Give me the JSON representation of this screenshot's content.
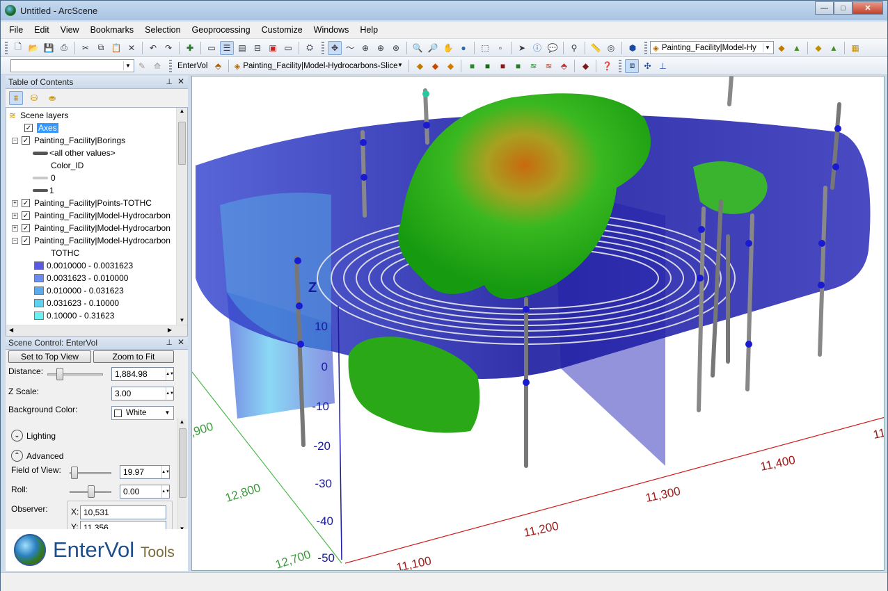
{
  "window": {
    "title": "Untitled - ArcScene",
    "minimize": "—",
    "maximize": "□",
    "close": "✕"
  },
  "menu": [
    "File",
    "Edit",
    "View",
    "Bookmarks",
    "Selection",
    "Geoprocessing",
    "Customize",
    "Windows",
    "Help"
  ],
  "toolbar": {
    "layer_combo": "Painting_Facility|Model-Hy",
    "entervol_label": "EnterVol",
    "slice_combo": "Painting_Facility|Model-Hydrocarbons-Slice"
  },
  "toc": {
    "title": "Table of Contents",
    "root": "Scene layers",
    "rows": [
      {
        "label": "Axes"
      },
      {
        "label": "Painting_Facility|Borings"
      },
      {
        "label": "<all other values>"
      },
      {
        "label": "Color_ID"
      },
      {
        "label": "0"
      },
      {
        "label": "1"
      },
      {
        "label": "Painting_Facility|Points-TOTHC"
      },
      {
        "label": "Painting_Facility|Model-Hydrocarbon"
      },
      {
        "label": "Painting_Facility|Model-Hydrocarbon"
      },
      {
        "label": "Painting_Facility|Model-Hydrocarbon"
      },
      {
        "label": "TOTHC"
      }
    ],
    "legend": [
      {
        "label": "0.0010000 - 0.0031623",
        "color": "#5a5ae6"
      },
      {
        "label": "0.0031623 - 0.010000",
        "color": "#6b8cf0"
      },
      {
        "label": "0.010000 - 0.031623",
        "color": "#5aaaf0"
      },
      {
        "label": "0.031623 - 0.10000",
        "color": "#5ad2f0"
      },
      {
        "label": "0.10000 - 0.31623",
        "color": "#6af0f0"
      }
    ]
  },
  "scene_control": {
    "title": "Scene Control: EnterVol",
    "top_view": "Set to Top View",
    "zoom_fit": "Zoom to Fit",
    "distance_label": "Distance:",
    "distance": "1,884.98",
    "zscale_label": "Z Scale:",
    "zscale": "3.00",
    "bg_label": "Background Color:",
    "bg_value": "White",
    "lighting": "Lighting",
    "advanced": "Advanced",
    "fov_label": "Field of View:",
    "fov": "19.97",
    "roll_label": "Roll:",
    "roll": "0.00",
    "observer_label": "Observer:",
    "obs_x_label": "X:",
    "obs_x": "10,531",
    "obs_y_label": "Y:",
    "obs_y": "11,356"
  },
  "logo": {
    "main": "EnterVol",
    "sub": "Tools"
  },
  "scene_view": {
    "z_axis_title": "Z",
    "z_ticks": [
      "10",
      "0",
      "-10",
      "-20",
      "-30",
      "-40",
      "-50"
    ],
    "x_ticks": [
      "11,100",
      "11,200",
      "11,300",
      "11,400",
      "11"
    ],
    "y_ticks": [
      "12,700",
      "12,800",
      ",900"
    ]
  }
}
